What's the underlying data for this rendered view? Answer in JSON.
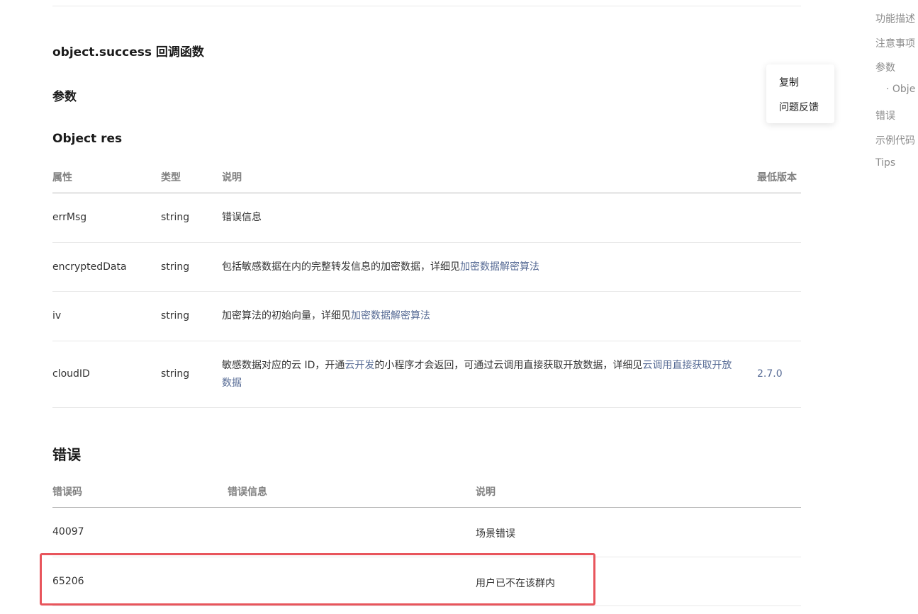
{
  "sections": {
    "success_title": "object.success 回调函数",
    "params_title": "参数",
    "object_res_title": "Object res",
    "errors_title": "错误"
  },
  "res_table": {
    "headers": [
      "属性",
      "类型",
      "说明",
      "最低版本"
    ],
    "rows": [
      {
        "name": "errMsg",
        "type": "string",
        "desc": "错误信息",
        "version": ""
      },
      {
        "name": "encryptedData",
        "type": "string",
        "desc_text": "包括敏感数据在内的完整转发信息的加密数据，详细见",
        "desc_link": "加密数据解密算法",
        "version": ""
      },
      {
        "name": "iv",
        "type": "string",
        "desc_text": "加密算法的初始向量，详细见",
        "desc_link": "加密数据解密算法",
        "version": ""
      },
      {
        "name": "cloudID",
        "type": "string",
        "desc_part1": "敏感数据对应的云 ID，开通",
        "desc_link1": "云开发",
        "desc_part2": "的小程序才会返回，可通过云调用直接获取开放数据，详细见",
        "desc_link2": "云调用直接获取开放数据",
        "version": "2.7.0"
      }
    ]
  },
  "error_table": {
    "headers": [
      "错误码",
      "错误信息",
      "说明"
    ],
    "rows": [
      {
        "code": "40097",
        "msg": "",
        "desc": "场景错误"
      },
      {
        "code": "65206",
        "msg": "",
        "desc": "用户已不在该群内"
      }
    ]
  },
  "popup_menu": {
    "copy": "复制",
    "feedback": "问题反馈"
  },
  "toc": [
    "功能描述",
    "注意事项",
    "参数",
    "· Obje",
    "错误",
    "示例代码",
    "Tips"
  ],
  "colors": {
    "link": "#576b95",
    "highlight": "#e8555c"
  }
}
